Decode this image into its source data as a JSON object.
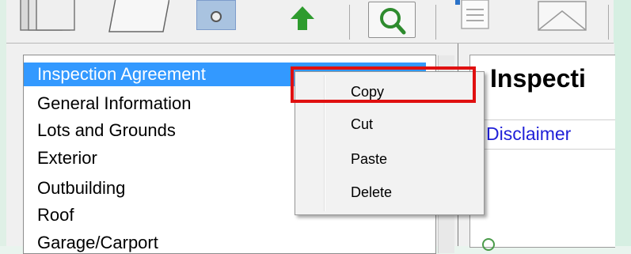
{
  "tree": {
    "items": [
      "Inspection Agreement",
      "General Information",
      "Lots and Grounds",
      "Exterior",
      "Outbuilding",
      "Roof",
      "Garage/Carport"
    ],
    "selected_index": 0
  },
  "context_menu": {
    "items": [
      "Copy",
      "Cut",
      "Paste",
      "Delete"
    ]
  },
  "right_panel": {
    "title": "Inspecti",
    "subtab": "Disclaimer"
  },
  "colors": {
    "selection": "#3399ff",
    "highlight_box": "#e01010",
    "link_text": "#2020d8",
    "accent_green": "#2e9b2e"
  }
}
